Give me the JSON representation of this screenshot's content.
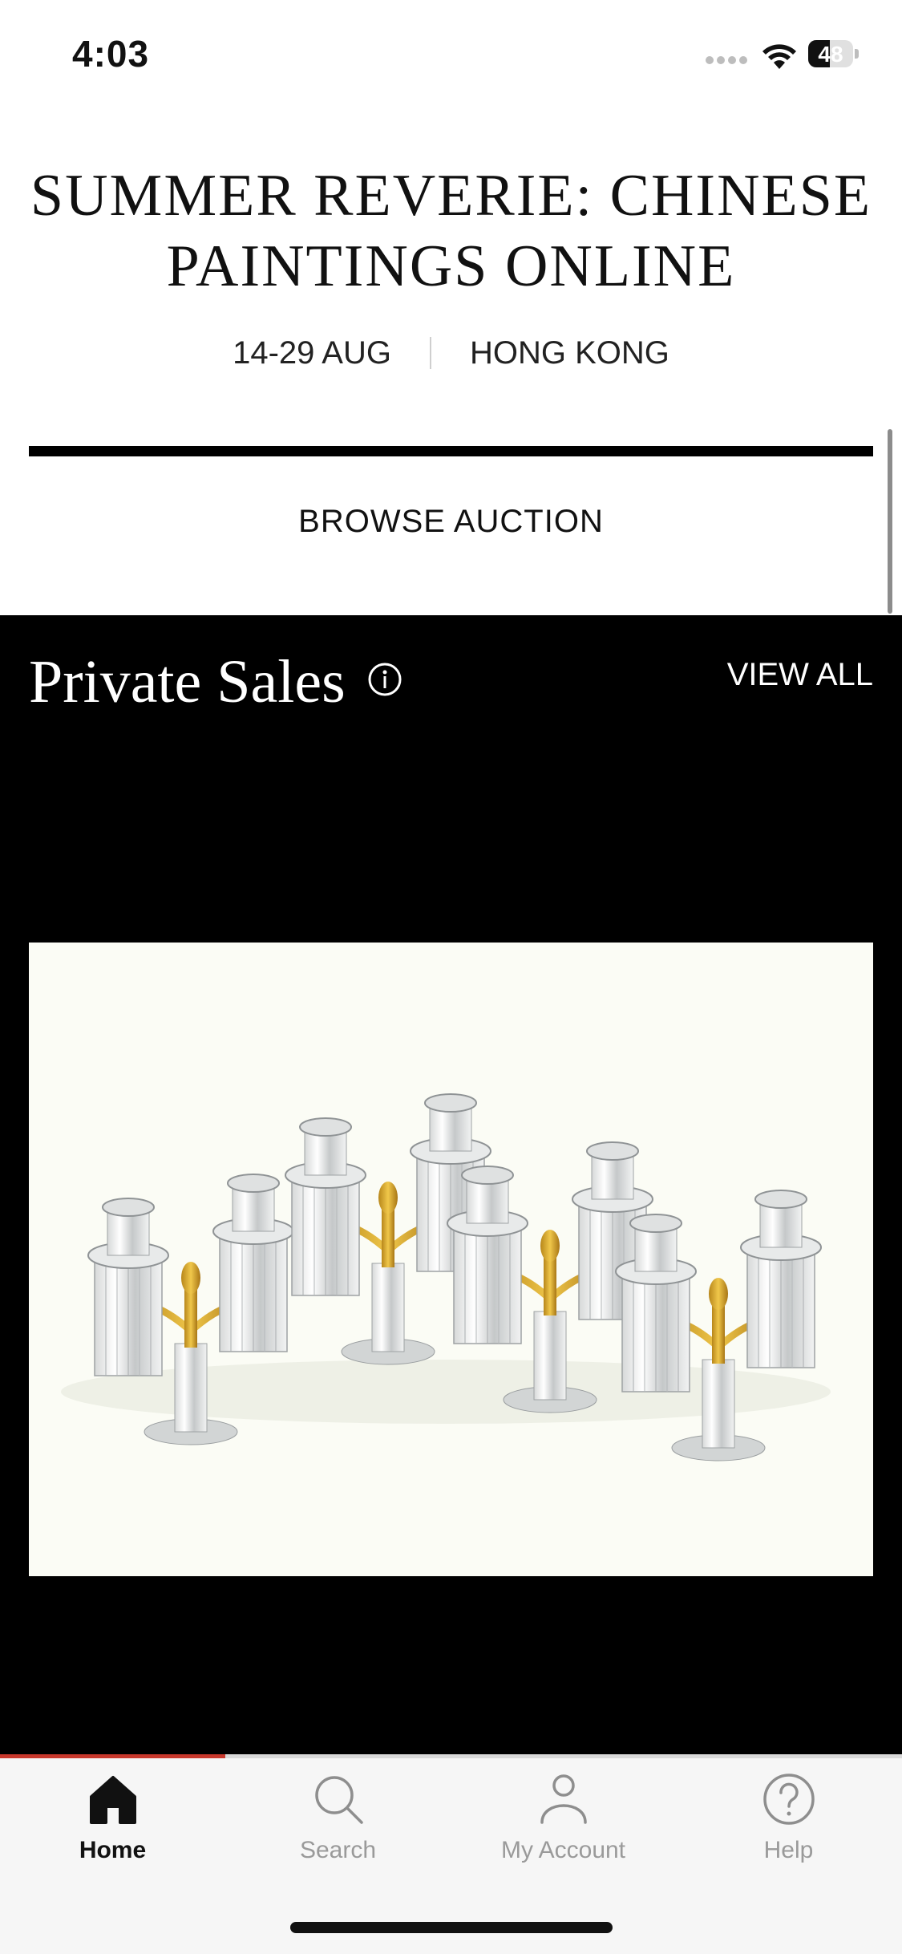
{
  "status_bar": {
    "time": "4:03",
    "battery_level": "48",
    "battery_fraction": 0.48
  },
  "auction": {
    "title": "SUMMER REVERIE: CHINESE PAINTINGS ONLINE",
    "dates": "14-29 AUG",
    "location": "HONG KONG",
    "browse_label": "BROWSE AUCTION"
  },
  "private_sales": {
    "title": "Private Sales",
    "view_all_label": "VIEW ALL",
    "image_subject": "pairs of cut-glass and ormolu candelabra"
  },
  "tab_bar": {
    "tabs": [
      {
        "label": "Home",
        "icon": "home-icon",
        "active": true
      },
      {
        "label": "Search",
        "icon": "search-icon",
        "active": false
      },
      {
        "label": "My Account",
        "icon": "account-icon",
        "active": false
      },
      {
        "label": "Help",
        "icon": "help-icon",
        "active": false
      }
    ],
    "progress_fraction": 0.25
  },
  "colors": {
    "accent": "#c8382c",
    "section_bg": "#000000",
    "tab_bar_bg": "#f6f6f6",
    "inactive_tab": "#9a9a9a"
  }
}
